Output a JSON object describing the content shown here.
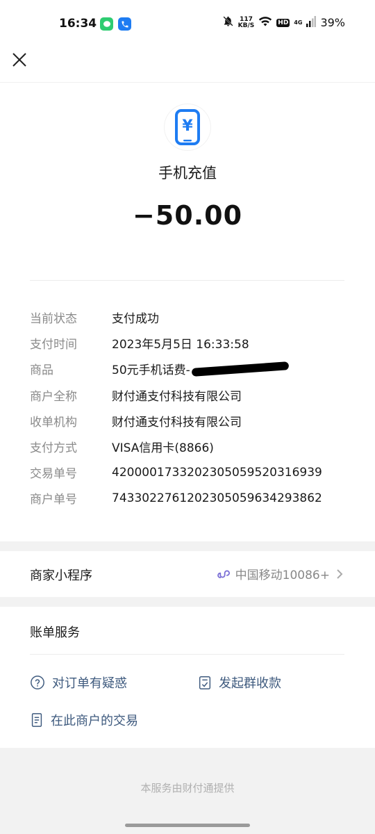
{
  "status_bar": {
    "time": "16:34",
    "net_speed_value": "117",
    "net_speed_unit": "KB/S",
    "hd_label": "HD",
    "network_label": "4G",
    "battery": "39%"
  },
  "hero": {
    "title": "手机充值",
    "amount": "−50.00",
    "icon_symbol": "¥"
  },
  "details": [
    {
      "label": "当前状态",
      "value": "支付成功"
    },
    {
      "label": "支付时间",
      "value": "2023年5月5日 16:33:58"
    },
    {
      "label": "商品",
      "value": "50元手机话费-"
    },
    {
      "label": "商户全称",
      "value": "财付通支付科技有限公司"
    },
    {
      "label": "收单机构",
      "value": "财付通支付科技有限公司"
    },
    {
      "label": "支付方式",
      "value": "VISA信用卡(8866)"
    },
    {
      "label": "交易单号",
      "value": "4200001733202305059520316939"
    },
    {
      "label": "商户单号",
      "value": "7433022761202305059634293862"
    }
  ],
  "mini_program": {
    "label": "商家小程序",
    "value": "中国移动10086+"
  },
  "services": {
    "title": "账单服务",
    "items": [
      {
        "label": "对订单有疑惑"
      },
      {
        "label": "发起群收款"
      },
      {
        "label": "在此商户的交易"
      }
    ]
  },
  "footer": {
    "text": "本服务由财付通提供"
  },
  "colors": {
    "accent_blue": "#1e7cf2",
    "link_text": "#3e5a7e",
    "mini_icon": "#7b6fd6",
    "gap_gray": "#f2f2f2"
  }
}
